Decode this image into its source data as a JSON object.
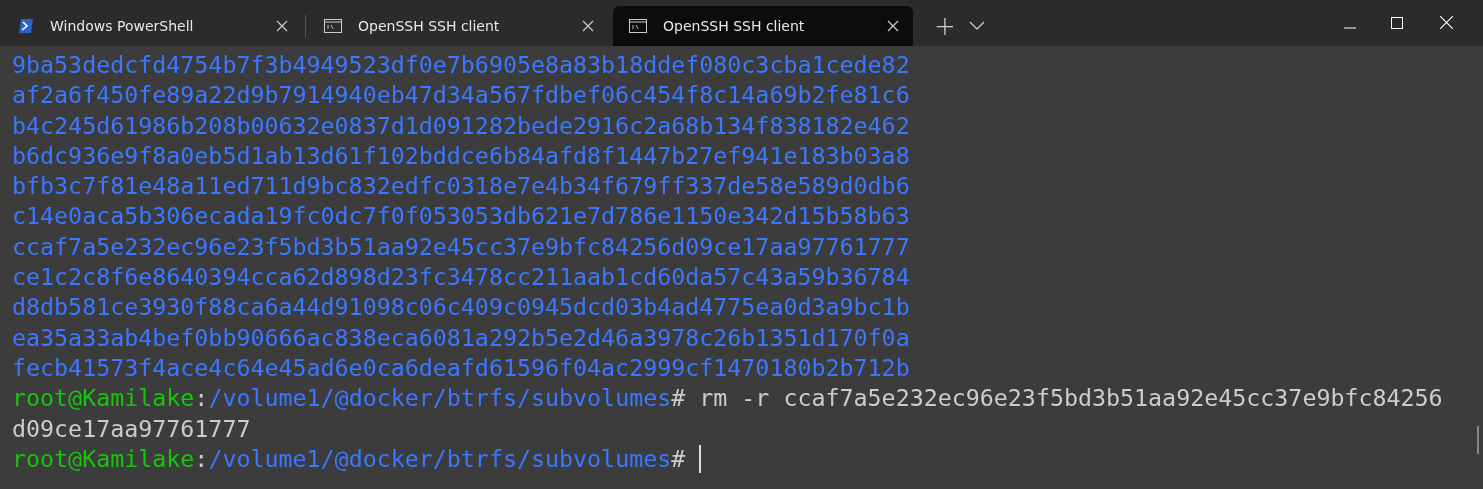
{
  "tabs": [
    {
      "title": "Windows PowerShell",
      "kind": "powershell",
      "selected": false
    },
    {
      "title": "OpenSSH SSH client",
      "kind": "console",
      "selected": false
    },
    {
      "title": "OpenSSH SSH client",
      "kind": "console",
      "selected": true
    }
  ],
  "new_tab": "+",
  "terminal": {
    "lines": [
      {
        "kind": "output",
        "text": "9ba53dedcfd4754b7f3b4949523df0e7b6905e8a83b18ddef080c3cba1cede82"
      },
      {
        "kind": "output",
        "text": "af2a6f450fe89a22d9b7914940eb47d34a567fdbef06c454f8c14a69b2fe81c6"
      },
      {
        "kind": "output",
        "text": "b4c245d61986b208b00632e0837d1d091282bede2916c2a68b134f838182e462"
      },
      {
        "kind": "output",
        "text": "b6dc936e9f8a0eb5d1ab13d61f102bddce6b84afd8f1447b27ef941e183b03a8"
      },
      {
        "kind": "output",
        "text": "bfb3c7f81e48a11ed711d9bc832edfc0318e7e4b34f679ff337de58e589d0db6"
      },
      {
        "kind": "output",
        "text": "c14e0aca5b306ecada19fc0dc7f0f053053db621e7d786e1150e342d15b58b63"
      },
      {
        "kind": "output",
        "text": "ccaf7a5e232ec96e23f5bd3b51aa92e45cc37e9bfc84256d09ce17aa97761777"
      },
      {
        "kind": "output",
        "text": "ce1c2c8f6e8640394cca62d898d23fc3478cc211aab1cd60da57c43a59b36784"
      },
      {
        "kind": "output",
        "text": "d8db581ce3930f88ca6a44d91098c06c409c0945dcd03b4ad4775ea0d3a9bc1b"
      },
      {
        "kind": "output",
        "text": "ea35a33ab4bef0bb90666ac838eca6081a292b5e2d46a3978c26b1351d170f0a"
      },
      {
        "kind": "output",
        "text": "fecb41573f4ace4c64e45ad6e0ca6deafd61596f04ac2999cf1470180b2b712b"
      },
      {
        "kind": "prompt",
        "user": "root@Kamilake",
        "sep": ":",
        "path": "/volume1/@docker/btrfs/subvolumes",
        "symbol": "#",
        "command": "rm -r ccaf7a5e232ec96e23f5bd3b51aa92e45cc37e9bfc84256",
        "cursor": false
      },
      {
        "kind": "plain",
        "text": "d09ce17aa97761777"
      },
      {
        "kind": "prompt",
        "user": "root@Kamilake",
        "sep": ":",
        "path": "/volume1/@docker/btrfs/subvolumes",
        "symbol": "#",
        "cursor": true
      }
    ]
  }
}
